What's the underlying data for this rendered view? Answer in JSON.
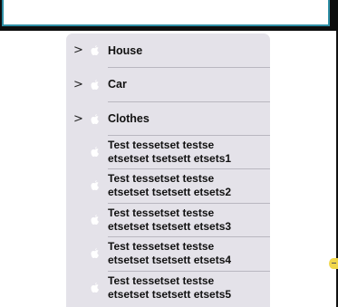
{
  "search": {
    "value": "",
    "placeholder": ""
  },
  "menu": {
    "items": [
      {
        "label": "House",
        "icon": "apple-icon",
        "has_submenu": true
      },
      {
        "label": "Car",
        "icon": "apple-icon",
        "has_submenu": true
      },
      {
        "label": "Clothes",
        "icon": "apple-icon",
        "has_submenu": true
      },
      {
        "line1": "Test tessetset testse",
        "line2": "etsetset tsetsett etsets1",
        "icon": "apple-icon"
      },
      {
        "line1": "Test tessetset testse",
        "line2": "etsetset tsetsett etsets2",
        "icon": "apple-icon"
      },
      {
        "line1": "Test tessetset testse",
        "line2": "etsetset tsetsett etsets3",
        "icon": "apple-icon"
      },
      {
        "line1": "Test tessetset testse",
        "line2": "etsetset tsetsett etsets4",
        "icon": "apple-icon"
      },
      {
        "line1": "Test tessetset testse",
        "line2": "etsetset tsetsett etsets5",
        "icon": "apple-icon"
      }
    ],
    "chevron": ">"
  },
  "colors": {
    "menu_background": "#e4e2e9",
    "field_border": "#2f8fa6",
    "topbar": "#0d0d0d"
  }
}
